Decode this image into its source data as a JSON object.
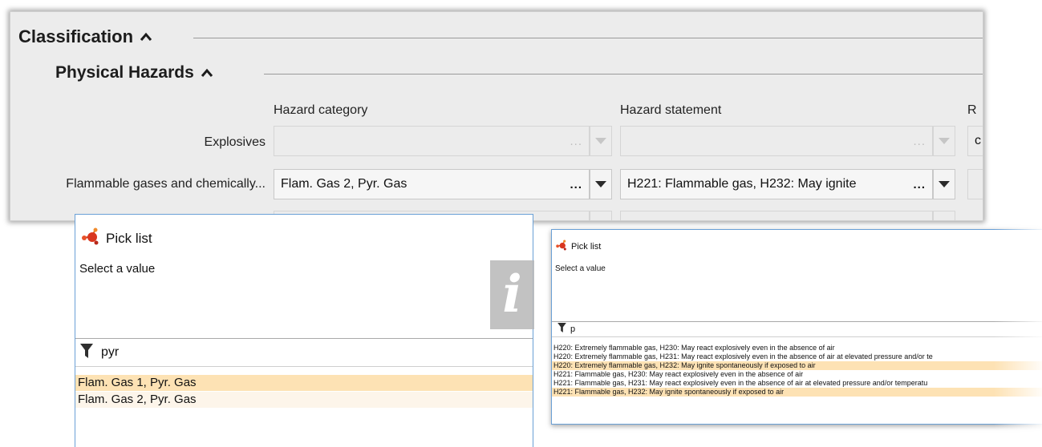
{
  "classification": {
    "title": "Classification",
    "physical_hazards": {
      "title": "Physical Hazards",
      "columns": {
        "category": "Hazard category",
        "statement": "Hazard statement",
        "third": "R"
      },
      "rows": [
        {
          "label": "Explosives",
          "category": "",
          "statement": "",
          "third": "c",
          "disabled": true
        },
        {
          "label": "Flammable gases and chemically...",
          "category": "Flam. Gas 2, Pyr. Gas",
          "statement": "H221: Flammable gas, H232: May ignite",
          "third": "",
          "disabled": false
        }
      ],
      "ellipsis": "..."
    }
  },
  "picklist_left": {
    "title": "Pick list",
    "prompt": "Select a value",
    "filter_value": "pyr",
    "results": [
      "Flam. Gas 1, Pyr. Gas",
      "Flam. Gas 2, Pyr. Gas"
    ]
  },
  "picklist_right": {
    "title": "Pick list",
    "prompt": "Select a value",
    "filter_value": "p",
    "results": [
      "H220: Extremely flammable gas, H230: May react explosively even in the absence of air",
      "H220: Extremely flammable gas, H231: May react explosively even in the absence of air at elevated pressure and/or te",
      "H220: Extremely flammable gas, H232: May ignite spontaneously if exposed to air",
      "H221: Flammable gas, H230: May react explosively even in the absence of air",
      "H221: Flammable gas, H231: May react explosively even in the absence of air at elevated pressure and/or temperatu",
      "H221: Flammable gas, H232: May ignite spontaneously if exposed to air"
    ]
  },
  "info_badge": {
    "glyph": "i"
  },
  "colors": {
    "panel_bg": "#ececec",
    "selected_row": "#fde2b4",
    "dialog_border": "#6aa0d6"
  },
  "icons": {
    "collapse": "chevron-up-icon",
    "dropdown": "triangle-down-icon",
    "dialog": "pick-list-molecule-icon",
    "filter": "funnel-icon",
    "info": "info-icon"
  }
}
